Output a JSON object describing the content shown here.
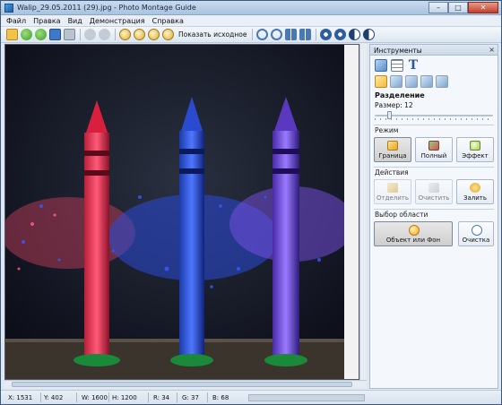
{
  "window": {
    "title": "Walip_29.05.2011 (29).jpg - Photo Montage Guide",
    "minimize": "–",
    "maximize": "□",
    "close": "✕"
  },
  "menu": {
    "items": [
      "Файл",
      "Правка",
      "Вид",
      "Демонстрация",
      "Справка"
    ]
  },
  "toolbar": {
    "show_original_label": "Показать исходное"
  },
  "panel": {
    "title": "Инструменты",
    "close": "×",
    "section_title": "Разделение",
    "size_label": "Размер: 12",
    "size_value": 12,
    "mode_label": "Режим",
    "mode_buttons": [
      "Граница",
      "Полный",
      "Эффект"
    ],
    "actions_label": "Действия",
    "action_buttons": [
      "Отделить",
      "Очистить",
      "Залить"
    ],
    "area_label": "Выбор области",
    "area_buttons": [
      "Объект или Фон",
      "Очистка"
    ]
  },
  "status": {
    "x": "X: 1531",
    "y": "Y: 402",
    "w": "W: 1600",
    "h": "H: 1200",
    "r": "R: 34",
    "g": "G: 37",
    "b": "B: 68"
  }
}
